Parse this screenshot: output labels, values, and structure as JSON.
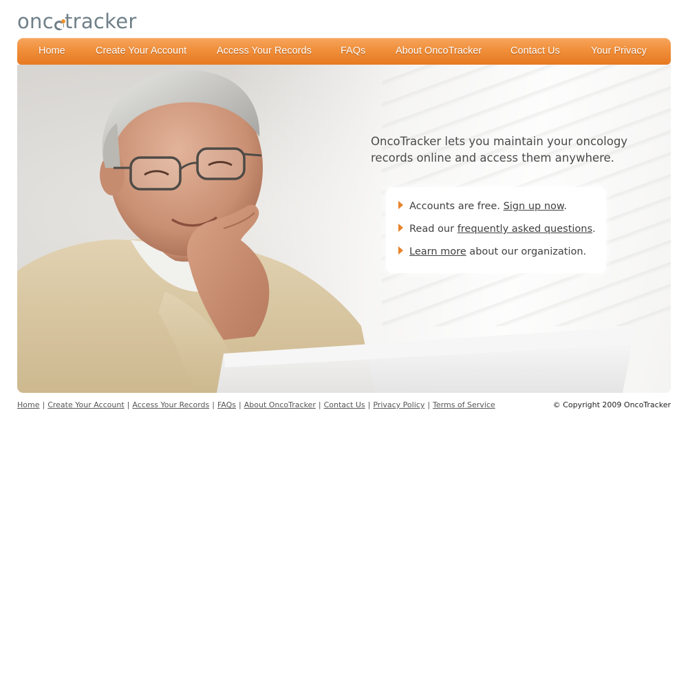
{
  "logo": {
    "text_before": "onc",
    "text_after": "tracker"
  },
  "nav": {
    "items": [
      {
        "label": "Home"
      },
      {
        "label": "Create Your Account"
      },
      {
        "label": "Access Your Records"
      },
      {
        "label": "FAQs"
      },
      {
        "label": "About OncoTracker"
      },
      {
        "label": "Contact Us"
      },
      {
        "label": "Your Privacy"
      }
    ]
  },
  "hero": {
    "headline": "OncoTracker lets you maintain your oncology records online and access them anywhere.",
    "lines": [
      {
        "before": "Accounts are free. ",
        "link": "Sign up now",
        "after": "."
      },
      {
        "before": "Read our ",
        "link": "frequently asked questions",
        "after": "."
      },
      {
        "before": "",
        "link": "Learn more",
        "after": " about our organization."
      }
    ]
  },
  "footer": {
    "links": [
      {
        "label": "Home"
      },
      {
        "label": "Create Your Account"
      },
      {
        "label": "Access Your Records"
      },
      {
        "label": "FAQs"
      },
      {
        "label": "About OncoTracker"
      },
      {
        "label": "Contact Us"
      },
      {
        "label": "Privacy Policy"
      },
      {
        "label": "Terms of Service"
      }
    ],
    "separator": "|",
    "copyright": "© Copyright 2009 OncoTracker"
  },
  "colors": {
    "accent_orange": "#f08f3a",
    "logo_gray": "#6f7f88",
    "text_dark": "#4a4a4a"
  }
}
